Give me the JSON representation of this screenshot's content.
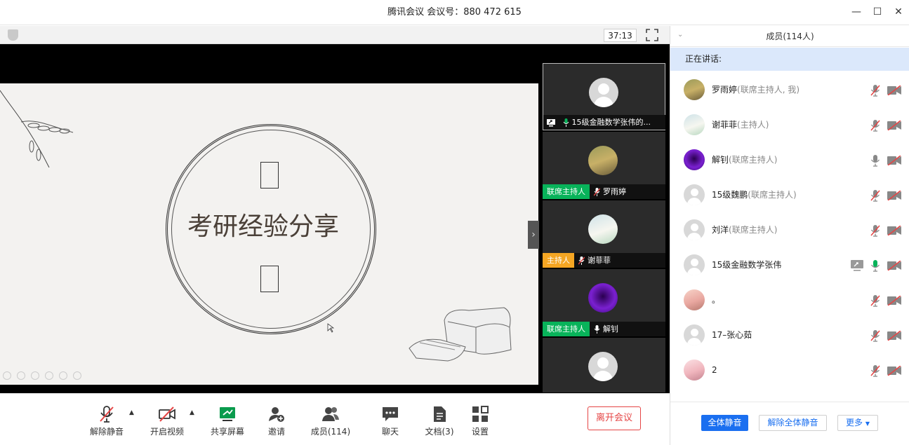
{
  "window": {
    "title": "腾讯会议  会议号：880 472 615",
    "minimize_icon": "minimize-icon",
    "maximize_icon": "maximize-icon",
    "close_icon": "close-icon"
  },
  "meeting": {
    "timer": "37:13"
  },
  "slide": {
    "title": "考研经验分享"
  },
  "tiles": [
    {
      "name": "15级金融数学张伟的...",
      "tag": "",
      "mic": "on",
      "sharing": true,
      "avatar": "default"
    },
    {
      "name": "罗雨婷",
      "tag": "联席主持人",
      "tag_color": "#08b35a",
      "mic": "muted",
      "avatar": "photo1"
    },
    {
      "name": "谢菲菲",
      "tag": "主持人",
      "tag_color": "#f5a623",
      "mic": "muted",
      "avatar": "photo2"
    },
    {
      "name": "解钊",
      "tag": "联席主持人",
      "tag_color": "#08b35a",
      "mic": "on",
      "avatar": "photo3"
    },
    {
      "name": "",
      "tag": "",
      "mic": "",
      "avatar": "default"
    }
  ],
  "toolbar": {
    "unmute_label": "解除静音",
    "video_label": "开启视频",
    "share_label": "共享屏幕",
    "invite_label": "邀请",
    "members_label": "成员(114)",
    "chat_label": "聊天",
    "docs_label": "文档(3)",
    "settings_label": "设置",
    "leave_label": "离开会议"
  },
  "panel": {
    "title": "成员(114人)",
    "speaking_label": "正在讲话:",
    "members": [
      {
        "name": "罗雨婷",
        "role": "(联席主持人, 我)",
        "mic": "muted",
        "cam": "off",
        "avatar": "p1"
      },
      {
        "name": "谢菲菲",
        "role": "(主持人)",
        "mic": "muted",
        "cam": "off",
        "avatar": "p2"
      },
      {
        "name": "解钊",
        "role": "(联席主持人)",
        "mic": "idle",
        "cam": "off",
        "avatar": "p3"
      },
      {
        "name": "15级魏鹏",
        "role": "(联席主持人)",
        "mic": "muted",
        "cam": "off",
        "avatar": "default"
      },
      {
        "name": "刘洋",
        "role": "(联席主持人)",
        "mic": "muted",
        "cam": "off",
        "avatar": "default"
      },
      {
        "name": "15级金融数学张伟",
        "role": "",
        "mic": "active",
        "cam": "off",
        "sharing": true,
        "avatar": "default"
      },
      {
        "name": "。",
        "role": "",
        "mic": "muted",
        "cam": "off",
        "avatar": "p4"
      },
      {
        "name": "17–张心茹",
        "role": "",
        "mic": "muted",
        "cam": "off",
        "avatar": "default"
      },
      {
        "name": "2",
        "role": "",
        "mic": "muted",
        "cam": "off",
        "avatar": "p5"
      }
    ],
    "mute_all_label": "全体静音",
    "unmute_all_label": "解除全体静音",
    "more_label": "更多"
  },
  "colors": {
    "accent": "#1a6ff0",
    "muted_red": "#e54545",
    "cohost_tag": "#08b35a",
    "host_tag": "#f5a623",
    "speaking_bg": "#dbe8fb"
  }
}
